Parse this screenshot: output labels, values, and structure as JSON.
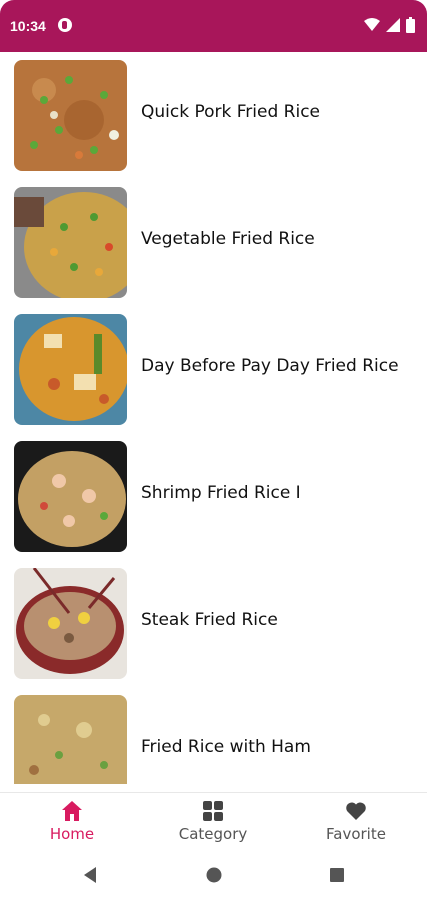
{
  "status": {
    "time": "10:34"
  },
  "recipes": [
    {
      "title": "Quick Pork Fried Rice"
    },
    {
      "title": "Vegetable Fried Rice"
    },
    {
      "title": "Day Before Pay Day Fried Rice"
    },
    {
      "title": "Shrimp Fried Rice I"
    },
    {
      "title": "Steak Fried Rice"
    },
    {
      "title": "Fried Rice with Ham"
    }
  ],
  "nav": {
    "items": [
      {
        "label": "Home",
        "icon": "home-icon",
        "active": true
      },
      {
        "label": "Category",
        "icon": "grid-icon",
        "active": false
      },
      {
        "label": "Favorite",
        "icon": "heart-icon",
        "active": false
      }
    ]
  },
  "colors": {
    "primary": "#a8165a",
    "accent": "#d81b60"
  }
}
